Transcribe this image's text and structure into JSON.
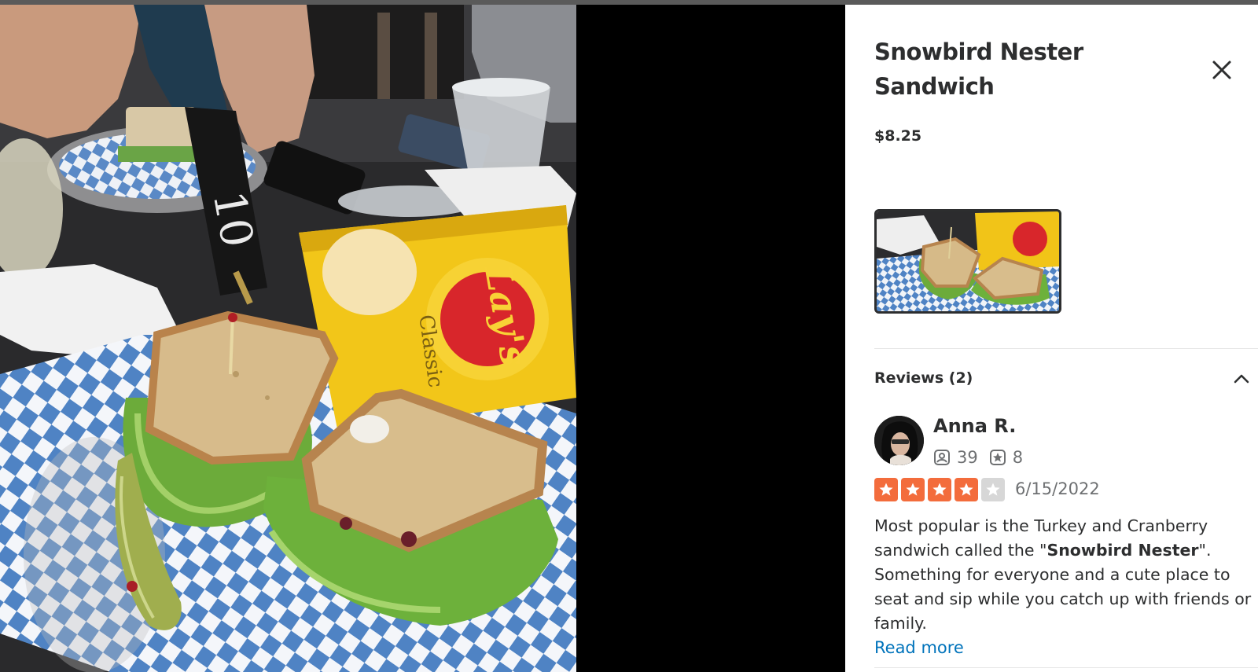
{
  "item": {
    "title_line1": "Snowbird Nester",
    "title_line2": "Sandwich",
    "price": "$8.25"
  },
  "photo": {
    "chip_bag_brand": "Lay's",
    "chip_bag_flavor": "Classic",
    "table_number": "10"
  },
  "reviews": {
    "header": "Reviews (2)",
    "items": [
      {
        "name": "Anna R.",
        "review_count": "39",
        "photo_count": "8",
        "rating": 4,
        "date": "6/15/2022",
        "text_before": "Most popular is the Turkey and Cranberry sandwich called the \"",
        "text_bold": "Snowbird Nester",
        "text_after": "\". Something for everyone and a cute place to seat and sip while you catch up with friends or family.",
        "read_more": "Read more"
      }
    ]
  },
  "colors": {
    "star_on": "#f36c3c",
    "star_off": "#d7d7d7",
    "link": "#0073bb",
    "text": "#2d2e2f"
  },
  "icons": {
    "close": "close-icon",
    "collapse": "chevron-up-icon",
    "reviews_stat": "review-count-icon",
    "photos_stat": "photo-count-icon",
    "star": "star-icon"
  }
}
